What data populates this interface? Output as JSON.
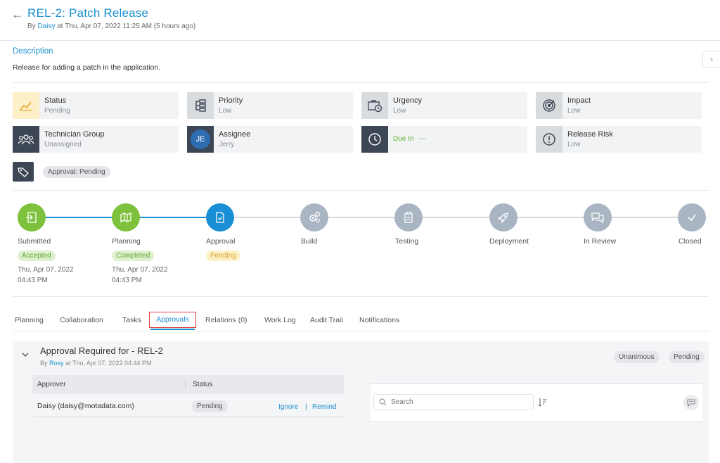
{
  "header": {
    "back_icon": "arrow-left-icon",
    "title": "REL-2: Patch Release",
    "by_prefix": "By",
    "author": "Daisy",
    "at_text": "at Thu, Apr 07, 2022 11:25 AM (5 hours ago)"
  },
  "description": {
    "title": "Description",
    "text": "Release for adding a patch in the application."
  },
  "side_toggle": "›",
  "cards": {
    "status": {
      "label": "Status",
      "value": "Pending",
      "icon": "chart-line-icon"
    },
    "priority": {
      "label": "Priority",
      "value": "Low",
      "icon": "flow-icon"
    },
    "urgency": {
      "label": "Urgency",
      "value": "Low",
      "icon": "briefcase-clock-icon"
    },
    "impact": {
      "label": "Impact",
      "value": "Low",
      "icon": "target-icon"
    },
    "technician_group": {
      "label": "Technician Group",
      "value": "Unassigned",
      "icon": "group-icon"
    },
    "assignee": {
      "label": "Assignee",
      "value": "Jerry",
      "avatar": "JE"
    },
    "due_in": {
      "label": "Due In",
      "value": "---",
      "icon": "clock-icon"
    },
    "release_risk": {
      "label": "Release Risk",
      "value": "Low",
      "icon": "alert-circle-icon"
    }
  },
  "tags": {
    "icon": "tag-icon",
    "approval_pill": "Approval: Pending"
  },
  "stages": [
    {
      "label": "Submitted",
      "badge": "Accepted",
      "date": "Thu, Apr 07, 2022",
      "time": "04:43 PM"
    },
    {
      "label": "Planning",
      "badge": "Completed",
      "date": "Thu, Apr 07, 2022",
      "time": "04:43 PM"
    },
    {
      "label": "Approval",
      "badge": "Pending"
    },
    {
      "label": "Build"
    },
    {
      "label": "Testing"
    },
    {
      "label": "Deployment"
    },
    {
      "label": "In Review"
    },
    {
      "label": "Closed"
    }
  ],
  "tabs": [
    "Planning",
    "Collaboration",
    "Tasks",
    "Approvals",
    "Relations (0)",
    "Work Log",
    "Audit Trail",
    "Notifications"
  ],
  "approval": {
    "title": "Approval Required for - REL-2",
    "by_prefix": "By",
    "author": "Rosy",
    "at_text": "at Thu, Apr 07, 2022 04:44 PM",
    "type_pill": "Unanimous",
    "status_pill": "Pending",
    "columns": [
      "Approver",
      "Status"
    ],
    "rows": [
      {
        "approver": "Daisy (daisy@motadata.com)",
        "status": "Pending",
        "ignore": "Ignore",
        "remind": "Remind"
      }
    ],
    "search_placeholder": "Search"
  },
  "colors": {
    "accent": "#1a8fce",
    "green": "#7dc13d",
    "grey_node": "#aab5c4",
    "dark_icon_bg": "#3c4654"
  }
}
